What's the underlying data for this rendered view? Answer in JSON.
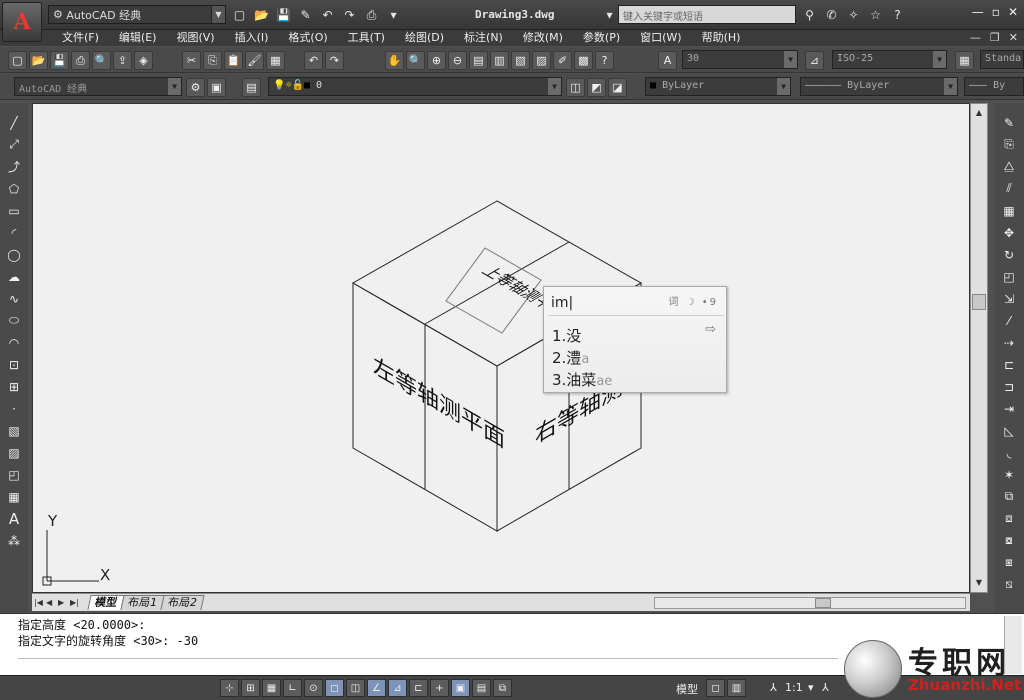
{
  "titlebar": {
    "workspace": "AutoCAD 经典",
    "document_title": "Drawing3.dwg",
    "search_placeholder": "键入关键字或短语",
    "help_icon": "question-icon"
  },
  "menu": {
    "items": [
      "文件(F)",
      "编辑(E)",
      "视图(V)",
      "插入(I)",
      "格式(O)",
      "工具(T)",
      "绘图(D)",
      "标注(N)",
      "修改(M)",
      "参数(P)",
      "窗口(W)",
      "帮助(H)"
    ]
  },
  "toolbar": {
    "text_height": "30",
    "dim_style": "ISO-25",
    "text_style": "Standa",
    "workspace_combo": "AutoCAD 经典",
    "layer_value": "0",
    "color_value": "ByLayer",
    "linetype_value": "ByLayer",
    "lineweight_value": "By"
  },
  "drawing": {
    "left_face_text": "左等轴测平面",
    "right_face_text": "右等轴测平面",
    "top_face_text": "上等轴测平面",
    "ucs_x": "X",
    "ucs_y": "Y"
  },
  "ime": {
    "composition": "im|",
    "tools": "词 ☽ •9",
    "candidates": [
      {
        "text": "1.没",
        "hint": ""
      },
      {
        "text": "2.澧",
        "hint": "a"
      },
      {
        "text": "3.油菜",
        "hint": "ae"
      }
    ]
  },
  "layout_tabs": [
    "模型",
    "布局1",
    "布局2"
  ],
  "command_line": {
    "line1": "指定高度 <20.0000>:",
    "line2": "指定文字的旋转角度 <30>: -30"
  },
  "statusbar": {
    "model_label": "模型",
    "scale_label": "1:1"
  },
  "watermark": {
    "title": "专职网",
    "url": "Zhuanzhi.Net"
  },
  "colors": {
    "chrome_dark": "#4a4a4a",
    "canvas_bg": "#f0f0f0",
    "logo_red": "#e63a2e",
    "watermark_red": "#d02020"
  }
}
